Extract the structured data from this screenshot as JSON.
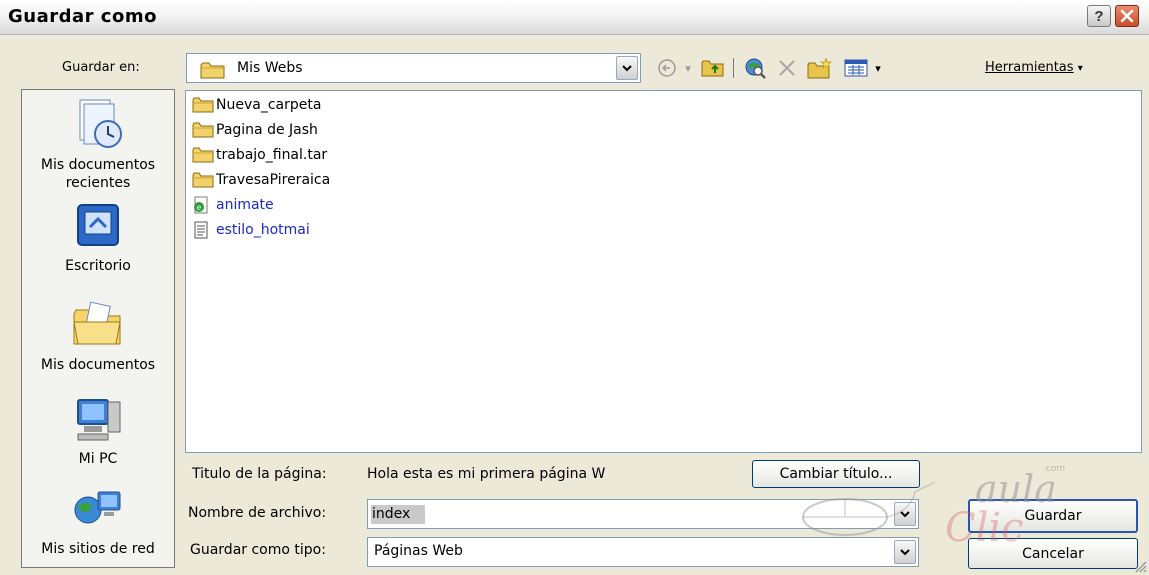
{
  "window": {
    "title": "Guardar como"
  },
  "lookin": {
    "label": "Guardar en:",
    "value": "Mis Webs"
  },
  "toolbar": {
    "tools_label": "Herramientas",
    "icons": [
      "back-icon",
      "up-folder-icon",
      "search-web-icon",
      "delete-icon",
      "new-folder-icon",
      "views-icon"
    ]
  },
  "places": [
    {
      "label": "Mis documentos recientes",
      "icon": "recent-documents-icon"
    },
    {
      "label": "Escritorio",
      "icon": "desktop-icon"
    },
    {
      "label": "Mis documentos",
      "icon": "my-documents-icon"
    },
    {
      "label": "Mi PC",
      "icon": "my-computer-icon"
    },
    {
      "label": "Mis sitios de red",
      "icon": "network-places-icon"
    }
  ],
  "files": [
    {
      "name": "Nueva_carpeta",
      "type": "folder"
    },
    {
      "name": "Pagina de Jash",
      "type": "folder"
    },
    {
      "name": "trabajo_final.tar",
      "type": "folder"
    },
    {
      "name": "TravesaPireraica",
      "type": "folder"
    },
    {
      "name": "animate",
      "type": "web"
    },
    {
      "name": "estilo_hotmai",
      "type": "web-doc"
    }
  ],
  "page_title": {
    "label": "Titulo de la página:",
    "value": "Hola esta es mi primera página W"
  },
  "buttons": {
    "change_title": "Cambiar título...",
    "save": "Guardar",
    "cancel": "Cancelar"
  },
  "filename": {
    "label": "Nombre de archivo:",
    "value": "index"
  },
  "savetype": {
    "label": "Guardar como tipo:",
    "value": "Páginas Web"
  },
  "watermark": {
    "line1": "aula",
    "line2": "Clic",
    "suffix": ".com"
  }
}
